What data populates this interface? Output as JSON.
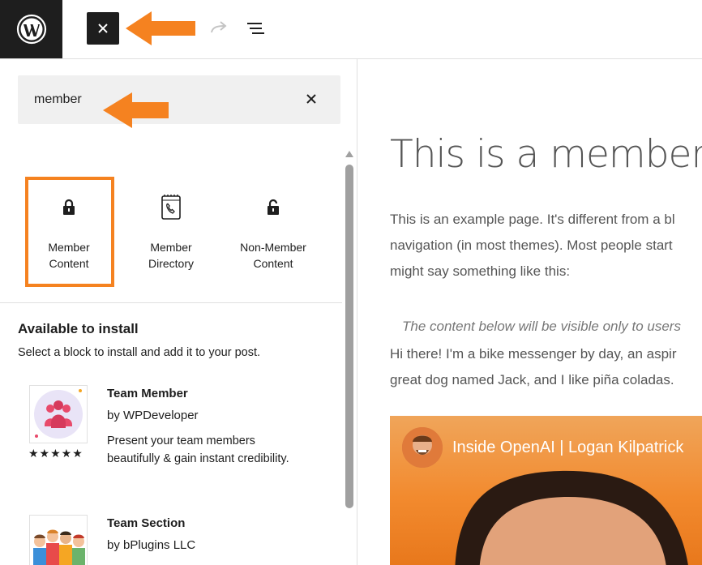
{
  "colors": {
    "accent_orange": "#f58220",
    "dark": "#1e1e1e",
    "text_gray": "#555555"
  },
  "toolbar": {
    "logo_icon": "wordpress-logo-icon",
    "close_icon": "close-icon",
    "redo_icon": "redo-icon",
    "list_view_icon": "list-view-icon"
  },
  "search": {
    "value": "member",
    "clear_icon": "close-icon"
  },
  "blocks": [
    {
      "label_line1": "Member",
      "label_line2": "Content",
      "icon": "lock-icon"
    },
    {
      "label_line1": "Member",
      "label_line2": "Directory",
      "icon": "directory-book-icon"
    },
    {
      "label_line1": "Non-Member",
      "label_line2": "Content",
      "icon": "unlock-icon"
    }
  ],
  "install": {
    "title": "Available to install",
    "description": "Select a block to install and add it to your post."
  },
  "plugins": [
    {
      "title": "Team Member",
      "author": "by WPDeveloper",
      "description": "Present your team members beautifully & gain instant credibility.",
      "stars": "★★★★★",
      "rating": 5
    },
    {
      "title": "Team Section",
      "author": "by bPlugins LLC"
    }
  ],
  "canvas": {
    "title": "This is a members-o",
    "para1_line1": "This is an example page. It's different from a bl",
    "para1_line2": "navigation (in most themes). Most people start",
    "para1_line3": "might say something like this:",
    "member_note": "The content below will be visible only to users",
    "para2_line1": "Hi there! I'm a bike messenger by day, an aspir",
    "para2_line2": "great dog named Jack, and I like piña coladas.",
    "video_title": "Inside OpenAI | Logan Kilpatrick"
  }
}
